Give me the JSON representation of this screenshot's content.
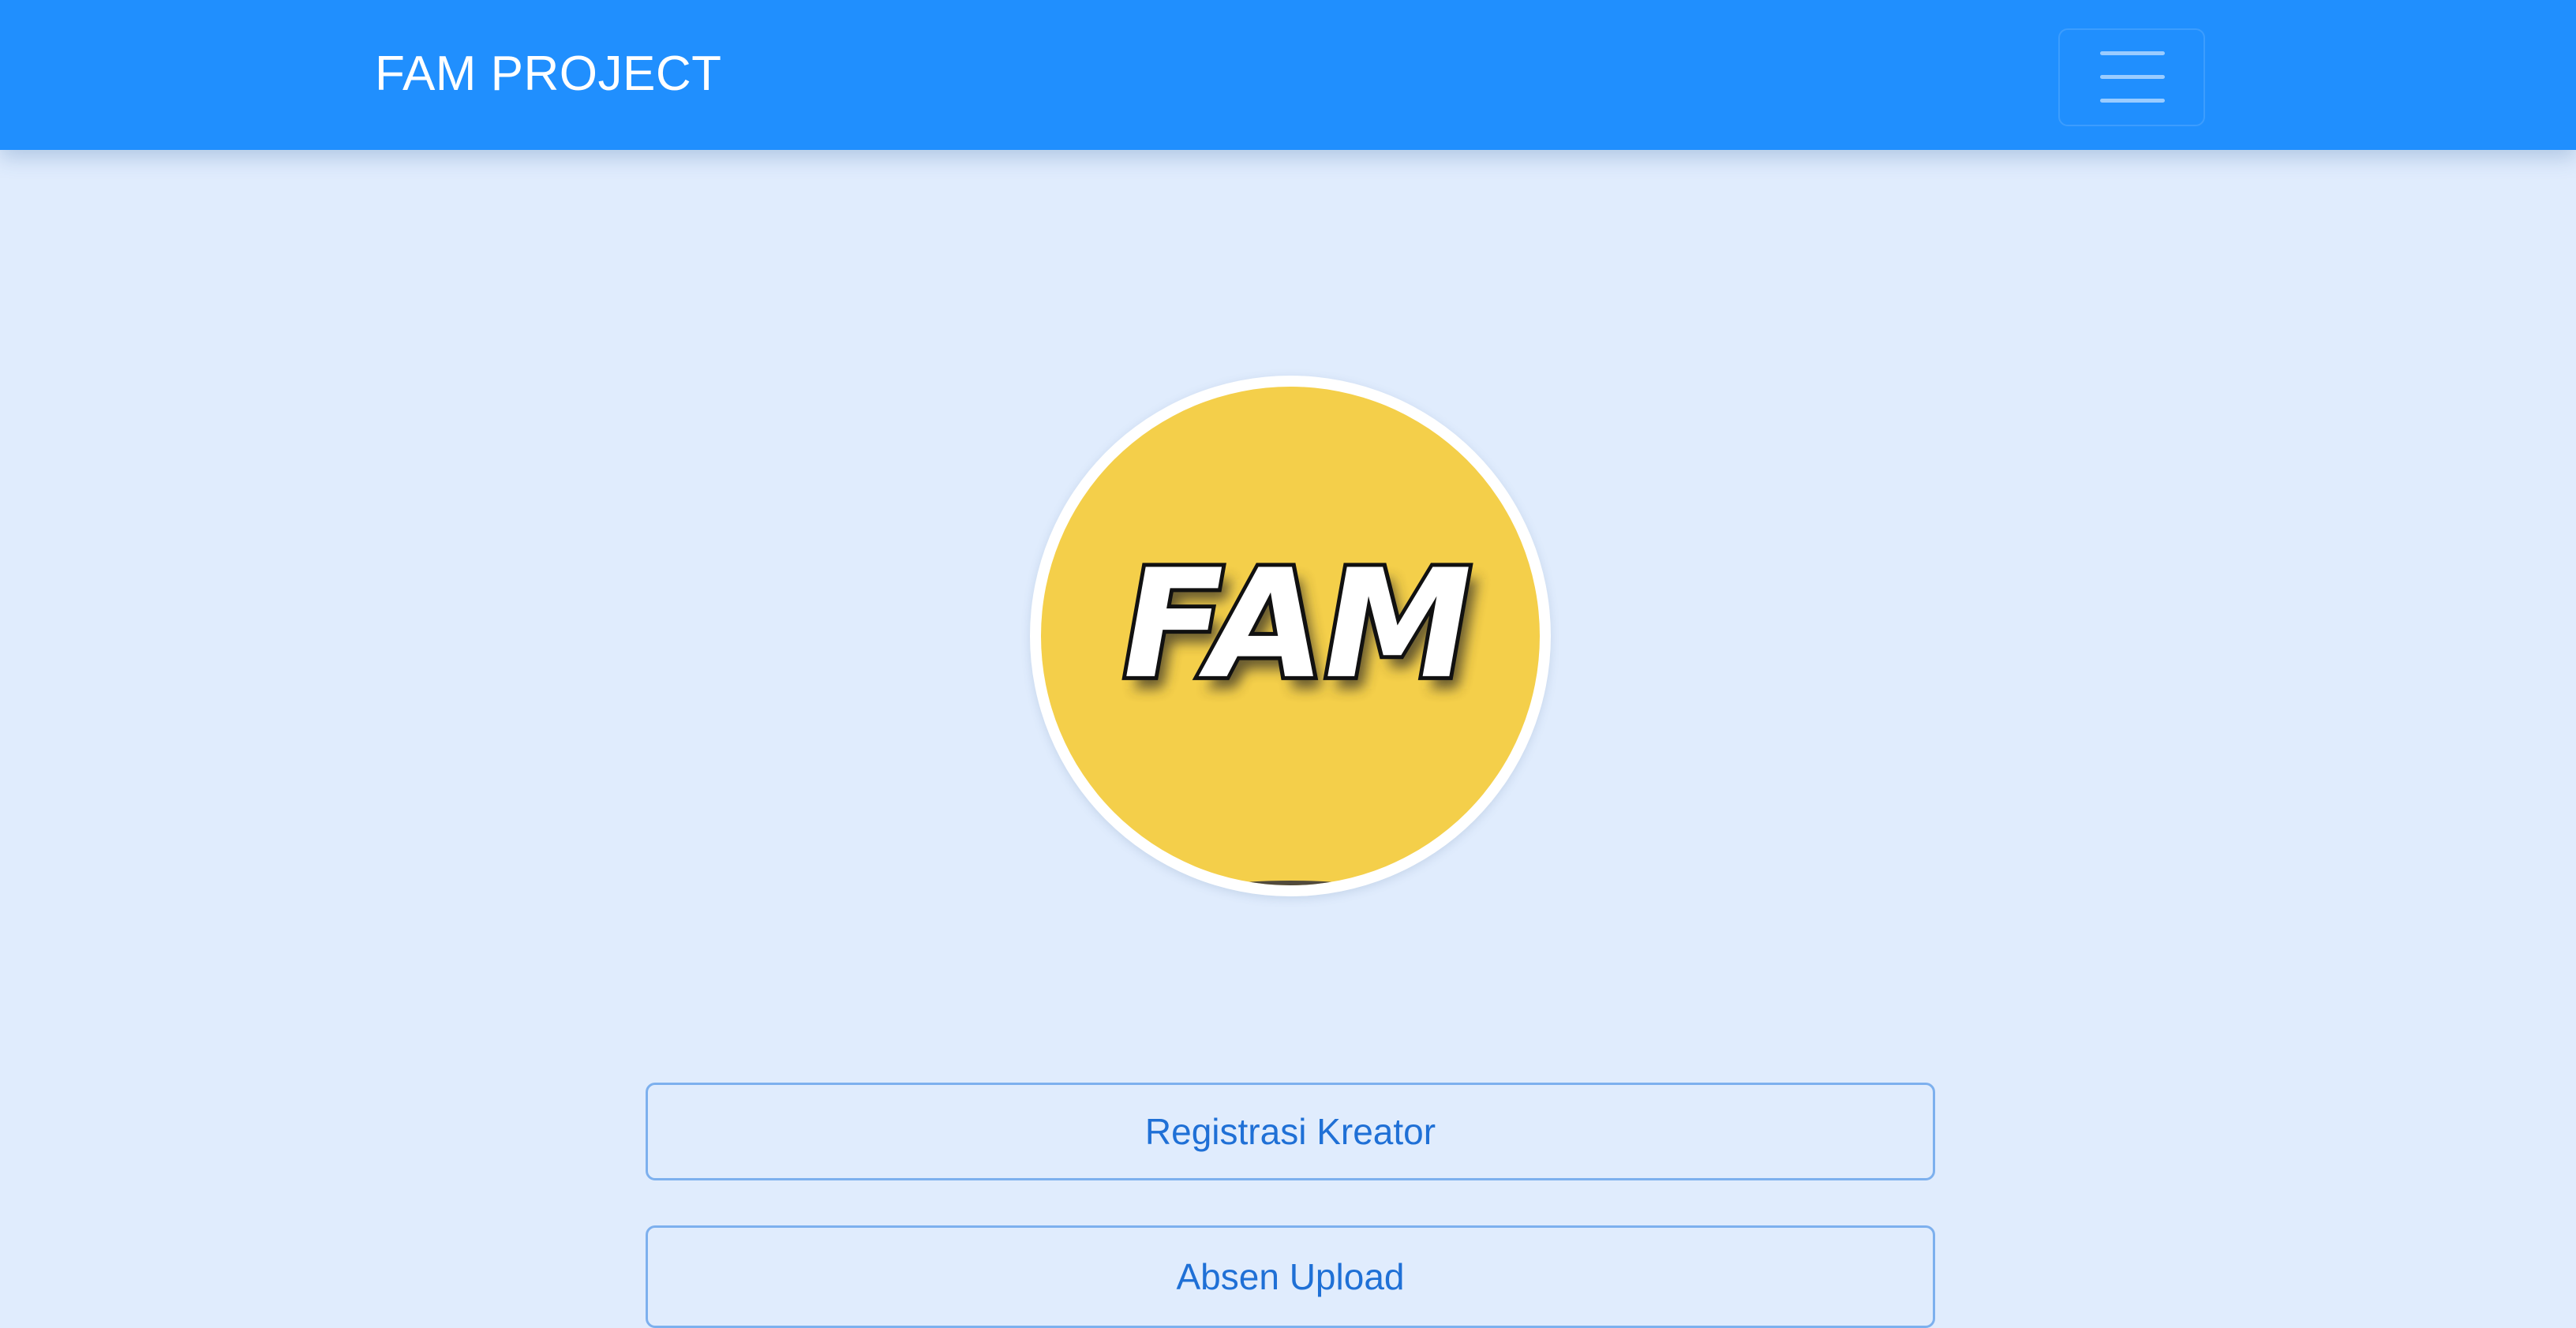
{
  "navbar": {
    "brand": "FAM PROJECT",
    "menu_icon": "hamburger-menu-icon",
    "background_color": "#208ffe"
  },
  "logo": {
    "text": "FAM",
    "background_color": "#f4cf4a"
  },
  "actions": {
    "registrasi_label": "Registrasi Kreator",
    "absen_label": "Absen Upload",
    "text_color": "#1f70d6",
    "border_color": "#7db0ee"
  },
  "page": {
    "background_color": "#e0ecfd"
  }
}
